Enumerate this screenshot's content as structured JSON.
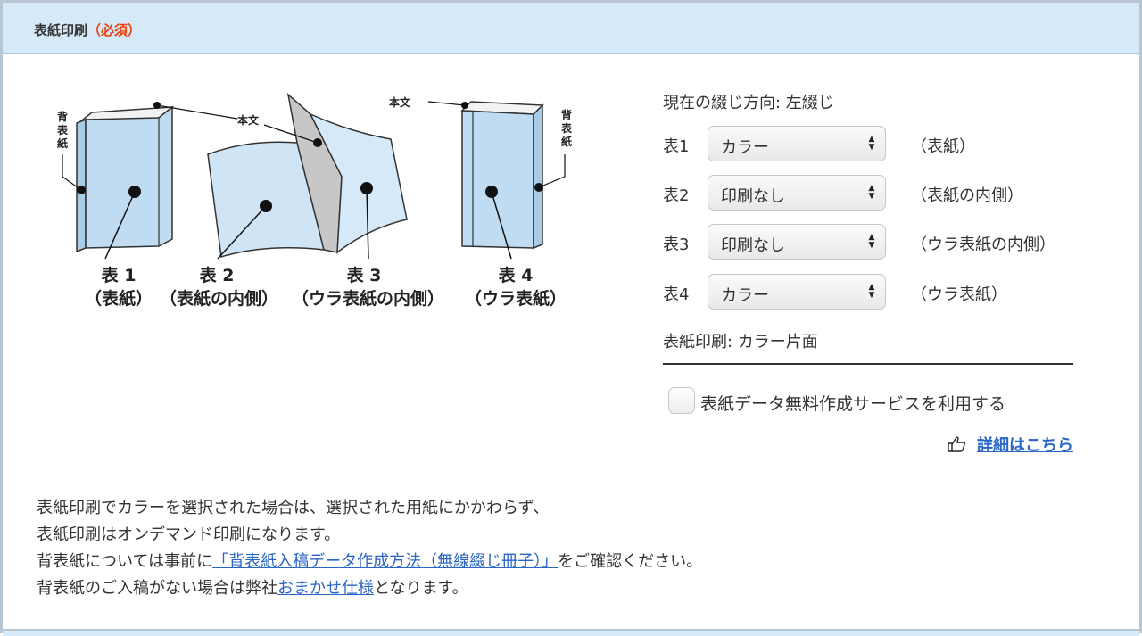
{
  "section": {
    "title": "表紙印刷",
    "required": "（必須）"
  },
  "diagram": {
    "labels": {
      "honbun": "本文",
      "sebyoushi": "背表紙"
    },
    "covers": [
      {
        "name": "表 1",
        "desc": "（表紙）"
      },
      {
        "name": "表 2",
        "desc": "（表紙の内側）"
      },
      {
        "name": "表 3",
        "desc": "（ウラ表紙の内側）"
      },
      {
        "name": "表 4",
        "desc": "（ウラ表紙）"
      }
    ]
  },
  "panel": {
    "binding_direction": "現在の綴じ方向: 左綴じ",
    "rows": [
      {
        "label": "表1",
        "value": "カラー",
        "note": "（表紙）"
      },
      {
        "label": "表2",
        "value": "印刷なし",
        "note": "（表紙の内側）"
      },
      {
        "label": "表3",
        "value": "印刷なし",
        "note": "（ウラ表紙の内側）"
      },
      {
        "label": "表4",
        "value": "カラー",
        "note": "（ウラ表紙）"
      }
    ],
    "print_summary": "表紙印刷: カラー片面",
    "checkbox_label": "表紙データ無料作成サービスを利用する",
    "detail_link": "詳細はこちら",
    "detail_icon": "pointing-hand-icon"
  },
  "notes": {
    "line1": "表紙印刷でカラーを選択された場合は、選択された用紙にかかわらず、",
    "line2": "表紙印刷はオンデマンド印刷になります。",
    "line3_pre": "背表紙については事前に",
    "line3_link": "「背表紙入稿データ作成方法（無線綴じ冊子）」",
    "line3_post": "をご確認ください。",
    "line4_pre": "背表紙のご入稿がない場合は弊社",
    "line4_link": "おまかせ仕様",
    "line4_post": "となります。"
  },
  "colors": {
    "header_bg": "#d6e9f8",
    "border": "#b8c6d3",
    "required": "#e8420c",
    "link": "#2a66c6",
    "book_blue": "#bfdcf2"
  }
}
